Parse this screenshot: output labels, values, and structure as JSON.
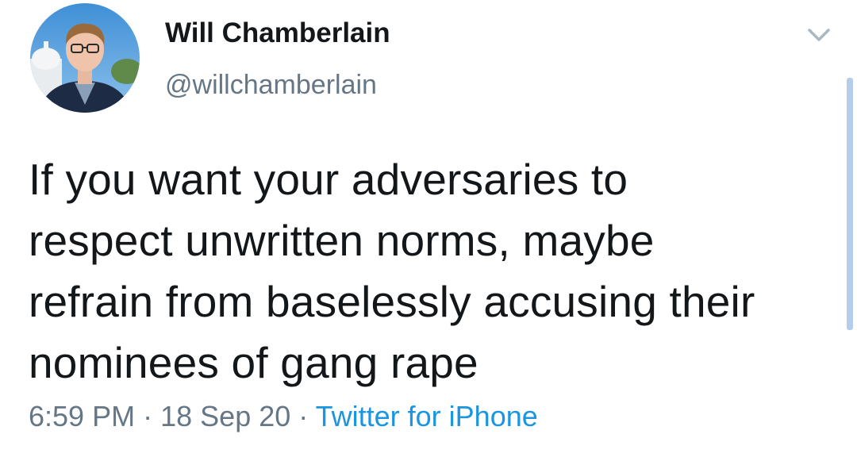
{
  "author": {
    "display_name": "Will Chamberlain",
    "handle": "@willchamberlain"
  },
  "tweet": {
    "lines": [
      "If you want your adversaries to",
      "respect unwritten norms, maybe",
      "refrain from baselessly accusing their",
      "nominees of gang rape"
    ],
    "time": "6:59 PM",
    "separator": "·",
    "date": "18 Sep 20",
    "source": "Twitter for iPhone"
  },
  "icons": {
    "menu": "chevron-down-icon",
    "avatar": "avatar"
  },
  "colors": {
    "text": "#14171a",
    "secondary": "#657786",
    "link": "#1b95e0",
    "chevron": "#aab8c2",
    "scrollbar": "#b3cdea"
  }
}
